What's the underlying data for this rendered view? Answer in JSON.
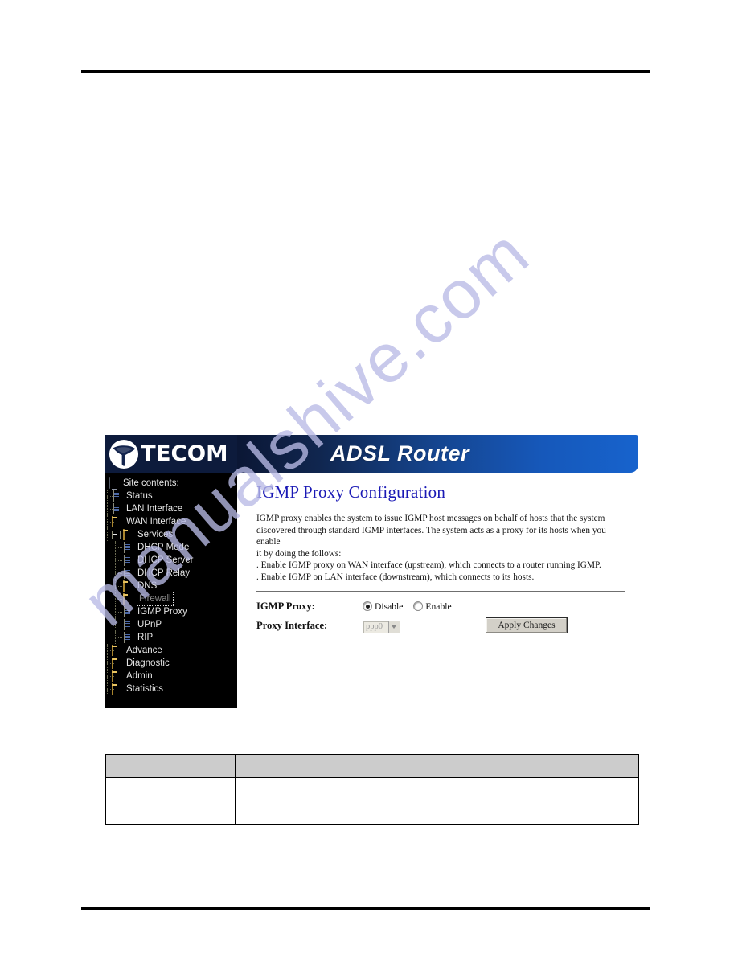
{
  "document": {
    "watermark_text": "manualshive.com"
  },
  "router_ui": {
    "brand": {
      "logo_icon": "tecom-bird-logo-icon",
      "wordmark": "TECOM"
    },
    "header": {
      "title": "ADSL Router"
    },
    "sidebar": {
      "root_label": "Site contents:",
      "root_icon": "monitor-icon",
      "items": [
        {
          "label": "Status",
          "icon": "page-icon",
          "depth": 1,
          "expander": false,
          "selected": false
        },
        {
          "label": "LAN Interface",
          "icon": "page-icon",
          "depth": 1,
          "expander": false,
          "selected": false
        },
        {
          "label": "WAN Interface",
          "icon": "folder-icon",
          "depth": 1,
          "expander": false,
          "selected": false
        },
        {
          "label": "Services",
          "icon": "folder-icon",
          "depth": 1,
          "expander": true,
          "selected": false
        },
        {
          "label": "DHCP Mode",
          "icon": "page-icon",
          "depth": 2,
          "expander": false,
          "selected": false
        },
        {
          "label": "DHCP Server",
          "icon": "page-icon",
          "depth": 2,
          "expander": false,
          "selected": false
        },
        {
          "label": "DHCP Relay",
          "icon": "page-icon",
          "depth": 2,
          "expander": false,
          "selected": false
        },
        {
          "label": "DNS",
          "icon": "folder-icon",
          "depth": 2,
          "expander": false,
          "selected": false
        },
        {
          "label": "Firewall",
          "icon": "folder-icon",
          "depth": 2,
          "expander": false,
          "selected": true
        },
        {
          "label": "IGMP Proxy",
          "icon": "page-icon",
          "depth": 2,
          "expander": false,
          "selected": false
        },
        {
          "label": "UPnP",
          "icon": "page-icon",
          "depth": 2,
          "expander": false,
          "selected": false
        },
        {
          "label": "RIP",
          "icon": "page-icon",
          "depth": 2,
          "expander": false,
          "selected": false
        },
        {
          "label": "Advance",
          "icon": "folder-icon",
          "depth": 1,
          "expander": false,
          "selected": false
        },
        {
          "label": "Diagnostic",
          "icon": "folder-icon",
          "depth": 1,
          "expander": false,
          "selected": false
        },
        {
          "label": "Admin",
          "icon": "folder-icon",
          "depth": 1,
          "expander": false,
          "selected": false
        },
        {
          "label": "Statistics",
          "icon": "folder-icon",
          "depth": 1,
          "expander": false,
          "selected": false
        }
      ]
    },
    "content": {
      "title": "IGMP Proxy Configuration",
      "description_lines": [
        "IGMP proxy enables the system to issue IGMP host messages on behalf of hosts that the system",
        "discovered through standard IGMP interfaces. The system acts as a proxy for its hosts when you enable",
        "it by doing the follows:",
        ". Enable IGMP proxy on WAN interface (upstream), which connects to a router running IGMP.",
        ". Enable IGMP on LAN interface (downstream), which connects to its hosts."
      ],
      "form": {
        "igmp_proxy_label": "IGMP Proxy:",
        "radio_disable_label": "Disable",
        "radio_enable_label": "Enable",
        "selected_radio": "Disable",
        "proxy_interface_label": "Proxy Interface:",
        "proxy_interface_value": "ppp0",
        "apply_button_label": "Apply Changes"
      }
    },
    "colors": {
      "title_blue": "#1a19b5",
      "header_dark": "#0a1430",
      "header_light": "#1763cd",
      "sidebar_bg": "#000000",
      "folder_yellow": "#f3d98a"
    }
  },
  "bottom_table": {
    "header_row": [
      "",
      ""
    ],
    "rows": [
      [
        "",
        ""
      ],
      [
        "",
        ""
      ]
    ]
  }
}
